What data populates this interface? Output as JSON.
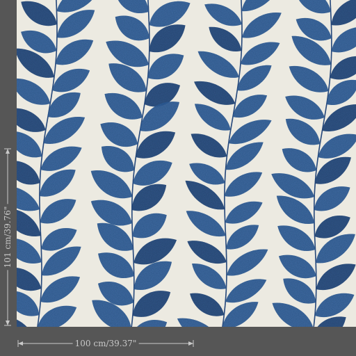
{
  "product": {
    "pattern_name": "",
    "colors": {
      "background": "#eceae1",
      "leaf": "#2f5f9c",
      "leaf_dark": "#23497f",
      "stem": "#2a4f86",
      "frame": "#565656",
      "dimension_text": "#c9c9c9"
    }
  },
  "dimensions": {
    "height_label": "101 cm/39.76\"",
    "width_label": "100 cm/39.37\""
  }
}
